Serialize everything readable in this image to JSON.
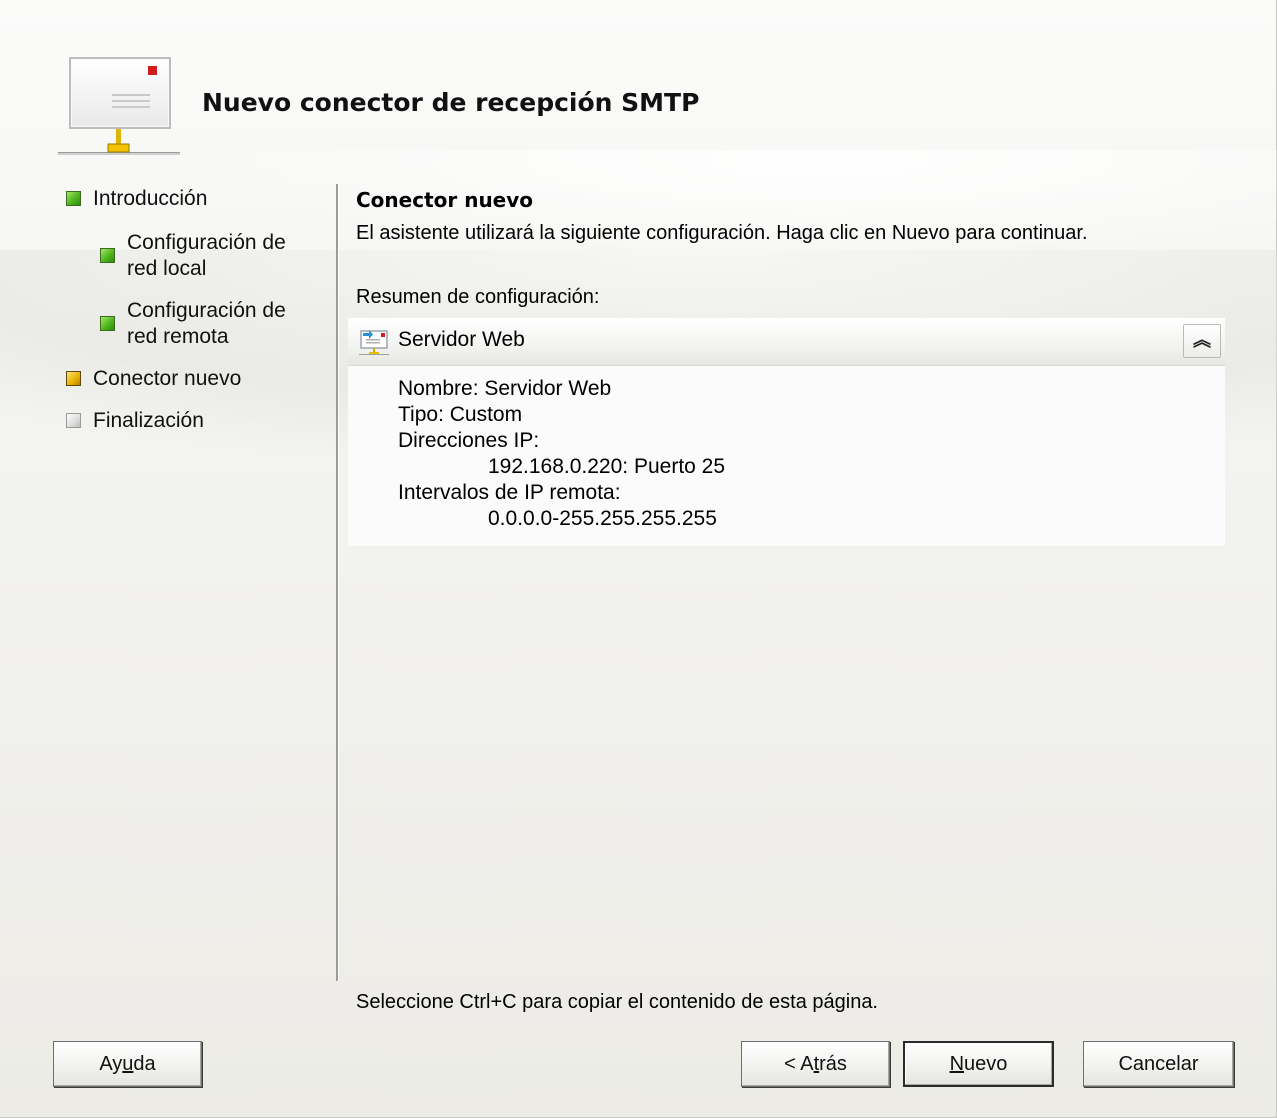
{
  "wizard": {
    "title": "Nuevo conector de recepción SMTP"
  },
  "nav": {
    "items": [
      {
        "label": "Introducción",
        "status": "completed"
      },
      {
        "label_line1": "Configuración de",
        "label_line2": "red local",
        "status": "completed"
      },
      {
        "label_line1": "Configuración de",
        "label_line2": "red remota",
        "status": "completed"
      },
      {
        "label": "Conector nuevo",
        "status": "current"
      },
      {
        "label": "Finalización",
        "status": "pending"
      }
    ]
  },
  "main": {
    "section_title": "Conector nuevo",
    "description": "El asistente utilizará la siguiente configuración. Haga clic en Nuevo para continuar.",
    "summary_label": "Resumen de configuración:",
    "panel": {
      "title": "Servidor Web",
      "collapse_glyph": "︽",
      "lines": {
        "nombre": "Nombre: Servidor Web",
        "tipo": "Tipo: Custom",
        "direcciones_label": "Direcciones IP:",
        "direccion_1": "192.168.0.220: Puerto 25",
        "intervalos_label": "Intervalos de IP remota:",
        "intervalo_1": "0.0.0.0-255.255.255.255"
      }
    },
    "footer_note": "Seleccione Ctrl+C para copiar el contenido de esta página."
  },
  "buttons": {
    "help_pre": "Ay",
    "help_key": "u",
    "help_post": "da",
    "back_pre": "< A",
    "back_key": "t",
    "back_post": "rás",
    "next_pre": "",
    "next_key": "N",
    "next_post": "uevo",
    "cancel": "Cancelar"
  },
  "colors": {
    "completed": "#4fb61d",
    "current": "#e8b000",
    "pending": "#dcdcdc"
  }
}
